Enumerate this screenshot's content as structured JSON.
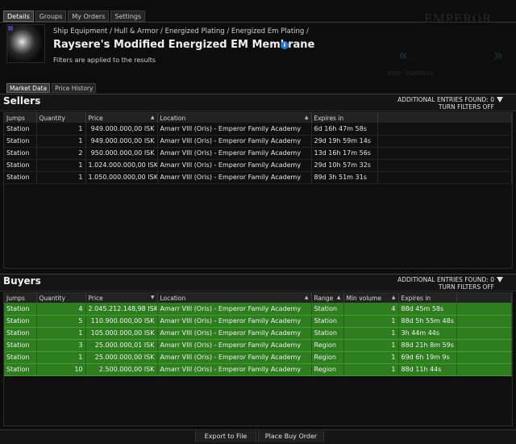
{
  "tabs": [
    "Details",
    "Groups",
    "My Orders",
    "Settings"
  ],
  "item": {
    "breadcrumb": "Ship Equipment / Hull & Armor / Energized Plating / Energized Em Plating /",
    "title": "Raysere's Modified Energized EM Membrane",
    "filters_note": "Filters are applied to the results",
    "info_icon": "info-icon"
  },
  "sub_tabs": [
    "Market Data",
    "Price History"
  ],
  "background": {
    "emperor": "EMPEROR",
    "ghost_text": "Item Statistics"
  },
  "sellers": {
    "title": "Sellers",
    "entries_found": "ADDITIONAL ENTRIES FOUND: 0",
    "turn_filters_off": "TURN FILTERS OFF",
    "columns": [
      "Jumps",
      "Quantity",
      "Price",
      "Location",
      "Expires in"
    ],
    "rows": [
      [
        "Station",
        "1",
        "949.000.000,00 ISK",
        "Amarr VIII (Oris) - Emperor Family Academy",
        "6d 16h 47m 58s"
      ],
      [
        "Station",
        "1",
        "949.000.000,00 ISK",
        "Amarr VIII (Oris) - Emperor Family Academy",
        "29d 19h 59m 14s"
      ],
      [
        "Station",
        "2",
        "950.000.000,00 ISK",
        "Amarr VIII (Oris) - Emperor Family Academy",
        "13d 16h 17m 56s"
      ],
      [
        "Station",
        "1",
        "1.024.000.000,00 ISK",
        "Amarr VIII (Oris) - Emperor Family Academy",
        "29d 10h 57m 32s"
      ],
      [
        "Station",
        "1",
        "1.050.000.000,00 ISK",
        "Amarr VIII (Oris) - Emperor Family Academy",
        "89d 3h 51m 31s"
      ]
    ]
  },
  "buyers": {
    "title": "Buyers",
    "entries_found": "ADDITIONAL ENTRIES FOUND: 0",
    "turn_filters_off": "TURN FILTERS OFF",
    "columns": [
      "Jumps",
      "Quantity",
      "Price",
      "Location",
      "Range",
      "Min volume",
      "Expires in"
    ],
    "rows": [
      [
        "Station",
        "4",
        "2.045.212.148,98 ISK",
        "Amarr VIII (Oris) - Emperor Family Academy",
        "Station",
        "4",
        "88d 45m 58s"
      ],
      [
        "Station",
        "5",
        "110.900.000,00 ISK",
        "Amarr VIII (Oris) - Emperor Family Academy",
        "Station",
        "1",
        "88d 5h 55m 48s"
      ],
      [
        "Station",
        "1",
        "105.000.000,00 ISK",
        "Amarr VIII (Oris) - Emperor Family Academy",
        "Station",
        "1",
        "3h 44m 44s"
      ],
      [
        "Station",
        "3",
        "25.000.000,01 ISK",
        "Amarr VIII (Oris) - Emperor Family Academy",
        "Region",
        "1",
        "88d 21h 8m 59s"
      ],
      [
        "Station",
        "1",
        "25.000.000,00 ISK",
        "Amarr VIII (Oris) - Emperor Family Academy",
        "Region",
        "1",
        "69d 6h 19m 9s"
      ],
      [
        "Station",
        "10",
        "2.500.000,00 ISK",
        "Amarr VIII (Oris) - Emperor Family Academy",
        "Region",
        "1",
        "88d 11h 44s"
      ]
    ]
  },
  "footer": {
    "export_label": "Export to File",
    "place_buy_label": "Place Buy Order"
  },
  "colors": {
    "buy_row": "#2e7d1f",
    "info_blue": "#2f72c9"
  }
}
